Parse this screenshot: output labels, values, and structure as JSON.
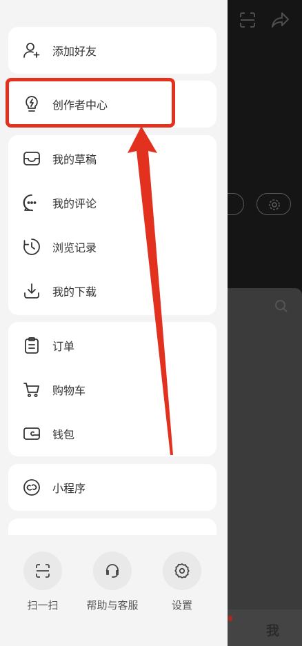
{
  "menu": {
    "add_friend": "添加好友",
    "creator_center": "创作者中心",
    "drafts": "我的草稿",
    "comments": "我的评论",
    "history": "浏览记录",
    "downloads": "我的下载",
    "orders": "订单",
    "cart": "购物车",
    "wallet": "钱包",
    "mini_programs": "小程序"
  },
  "footer": {
    "scan": "扫一扫",
    "help": "帮助与客服",
    "settings": "设置"
  },
  "background": {
    "me_tab": "我"
  },
  "colors": {
    "annotation": "#e2321f",
    "card_bg": "#ffffff",
    "drawer_bg": "#f4f4f4"
  }
}
